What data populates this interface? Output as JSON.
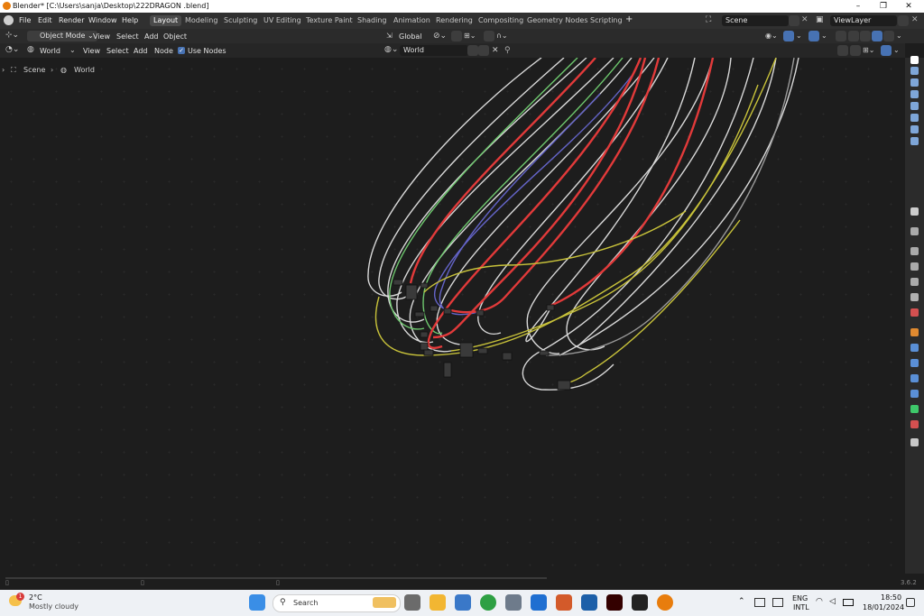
{
  "window": {
    "title": "Blender* [C:\\Users\\sanja\\Desktop\\222DRAGON .blend]"
  },
  "menubar": {
    "items": [
      "File",
      "Edit",
      "Render",
      "Window",
      "Help"
    ]
  },
  "workspaces": [
    "Layout",
    "Modeling",
    "Sculpting",
    "UV Editing",
    "Texture Paint",
    "Shading",
    "Animation",
    "Rendering",
    "Compositing",
    "Geometry Nodes",
    "Scripting"
  ],
  "active_workspace": "Layout",
  "add_workspace": "+",
  "scene": {
    "label": "Scene"
  },
  "viewlayer": {
    "label": "ViewLayer"
  },
  "viewport_header": {
    "mode": "Object Mode",
    "menus": [
      "View",
      "Select",
      "Add",
      "Object"
    ],
    "orientation": "Global"
  },
  "node_header": {
    "shader_type": "World",
    "menus": [
      "View",
      "Select",
      "Add",
      "Node"
    ],
    "use_nodes_label": "Use Nodes",
    "use_nodes_checked": true,
    "world_field": "World"
  },
  "breadcrumb": {
    "scene": "Scene",
    "world": "World"
  },
  "version": "3.6.2",
  "taskbar": {
    "weather_temp": "2°C",
    "weather_desc": "Mostly cloudy",
    "weather_badge": "1",
    "search_placeholder": "Search",
    "language": "ENG",
    "layout": "INTL",
    "time": "18:50",
    "date": "18/01/2024"
  },
  "colors": {
    "accent": "#4772b3",
    "red_link": "#e23a3a",
    "yellow_link": "#c8c23a",
    "white_link": "#d8d8d8",
    "blue_link": "#6464c8",
    "green_link": "#6ec86e"
  }
}
